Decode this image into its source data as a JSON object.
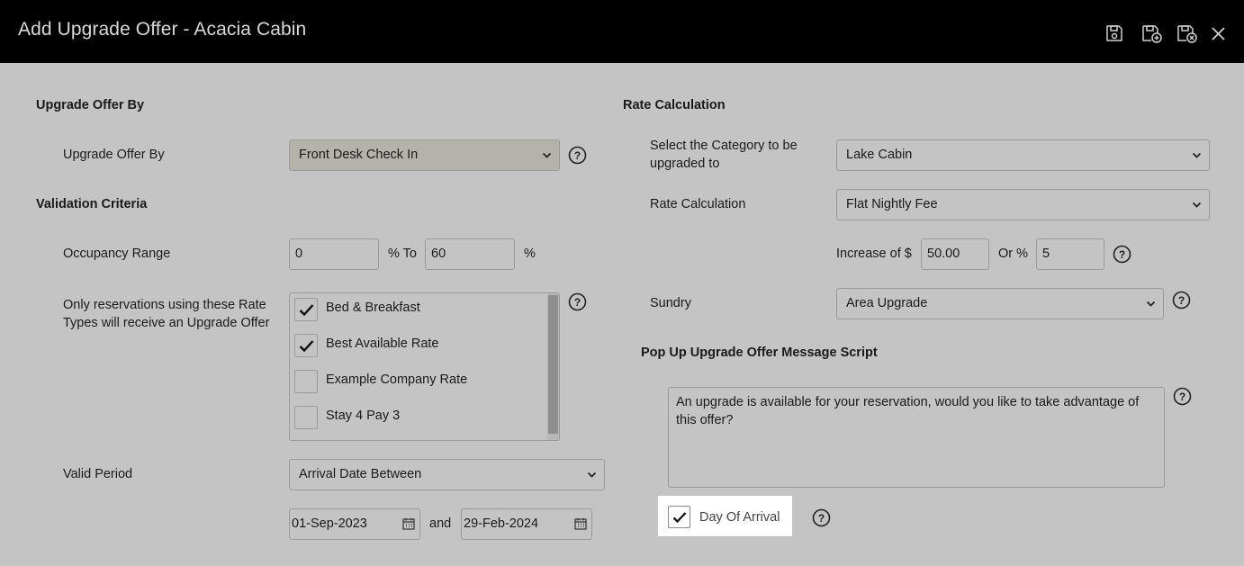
{
  "window": {
    "title": "Add Upgrade Offer - Acacia Cabin",
    "icons": [
      "save-icon",
      "save-new-icon",
      "save-close-icon",
      "close-icon"
    ]
  },
  "left": {
    "section1": "Upgrade Offer By",
    "upgrade_offer_by_label": "Upgrade Offer By",
    "upgrade_offer_by_value": "Front Desk Check In",
    "section2": "Validation Criteria",
    "occupancy_label": "Occupancy Range",
    "occupancy_from": "0",
    "occupancy_to_label": "% To",
    "occupancy_to": "60",
    "occupancy_pct": "%",
    "rate_types_label": "Only reservations using these Rate Types will receive an Upgrade Offer",
    "rate_types": [
      {
        "label": "Bed & Breakfast",
        "checked": true
      },
      {
        "label": "Best Available Rate",
        "checked": true
      },
      {
        "label": "Example Company Rate",
        "checked": false
      },
      {
        "label": "Stay 4 Pay 3",
        "checked": false
      }
    ],
    "valid_period_label": "Valid Period",
    "valid_period_value": "Arrival Date Between",
    "date_from": "01-Sep-2023",
    "and_label": "and",
    "date_to": "29-Feb-2024"
  },
  "right": {
    "section1": "Rate Calculation",
    "category_label": "Select the Category to be upgraded to",
    "category_value": "Lake Cabin",
    "rate_calc_label": "Rate Calculation",
    "rate_calc_value": "Flat Nightly Fee",
    "increase_label": "Increase of $",
    "increase_value": "50.00",
    "or_label": "Or %",
    "or_value": "5",
    "sundry_label": "Sundry",
    "sundry_value": "Area Upgrade",
    "section2": "Pop Up Upgrade Offer Message Script",
    "message": "An upgrade is available for your reservation, would you like to take advantage of this offer?",
    "day_of_arrival_label": "Day Of Arrival",
    "day_of_arrival_checked": true
  },
  "colors": {
    "titlebar": "#000000",
    "background": "#c4c4c4",
    "highlight": "#ffffff"
  }
}
